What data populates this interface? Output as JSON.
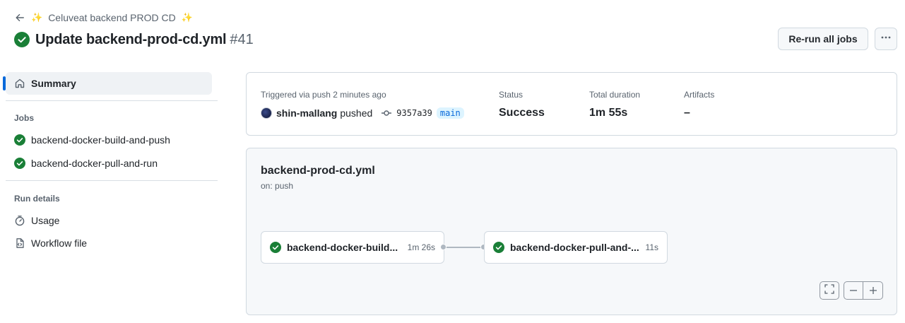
{
  "header": {
    "back_label": "Celuveat backend PROD CD",
    "sparkle": "✨",
    "title": "Update backend-prod-cd.yml",
    "run_number": "#41",
    "rerun_label": "Re-run all jobs"
  },
  "sidebar": {
    "summary_label": "Summary",
    "jobs_heading": "Jobs",
    "jobs": [
      {
        "label": "backend-docker-build-and-push"
      },
      {
        "label": "backend-docker-pull-and-run"
      }
    ],
    "run_details_heading": "Run details",
    "details": [
      {
        "label": "Usage"
      },
      {
        "label": "Workflow file"
      }
    ]
  },
  "summary": {
    "trigger_label": "Triggered via push 2 minutes ago",
    "actor": "shin-mallang",
    "action": "pushed",
    "commit_sha": "9357a39",
    "branch": "main",
    "status_label": "Status",
    "status_value": "Success",
    "duration_label": "Total duration",
    "duration_value": "1m 55s",
    "artifacts_label": "Artifacts",
    "artifacts_value": "–"
  },
  "workflow": {
    "file_name": "backend-prod-cd.yml",
    "trigger": "on: push",
    "jobs": [
      {
        "name": "backend-docker-build...",
        "duration": "1m 26s"
      },
      {
        "name": "backend-docker-pull-and-...",
        "duration": "11s"
      }
    ]
  },
  "colors": {
    "success": "#1a7f37",
    "accent": "#0969da",
    "muted_text": "#59636e"
  }
}
